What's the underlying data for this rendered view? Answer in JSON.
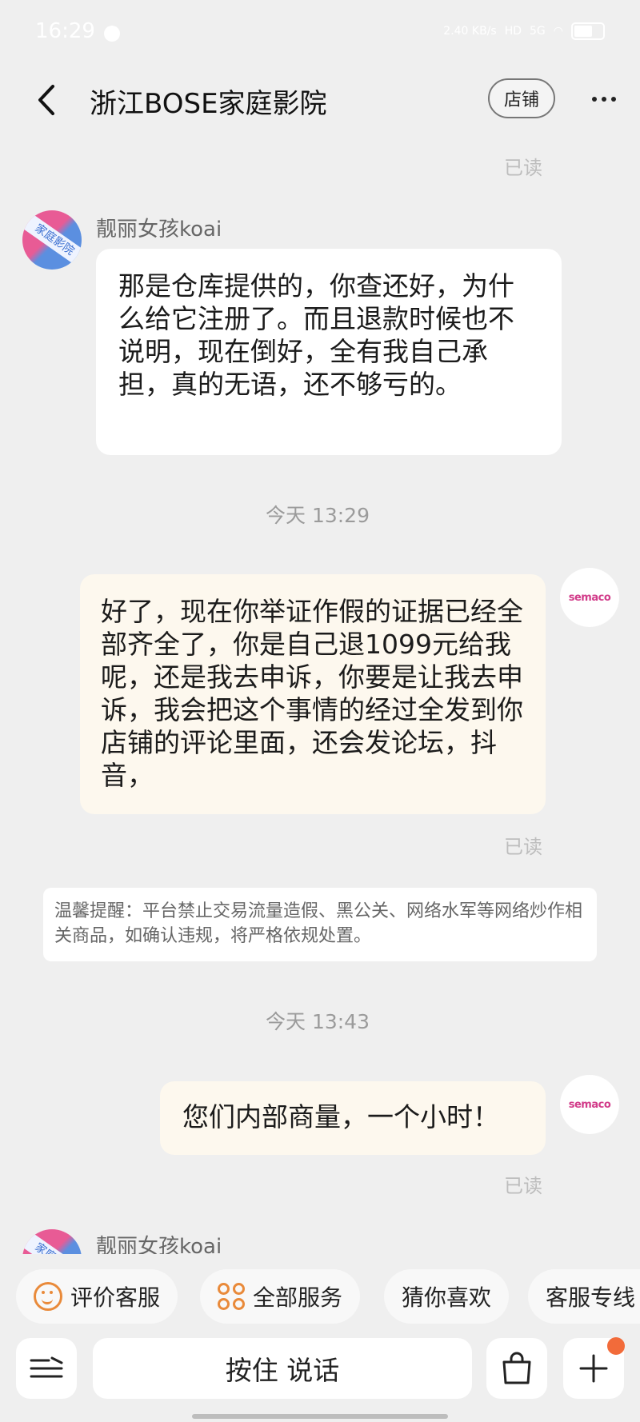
{
  "status_bar": {
    "time": "16:29",
    "speed": "2.40 KB/s",
    "hd": "HD",
    "network": "5G"
  },
  "header": {
    "title": "浙江BOSE家庭影院",
    "store_label": "店铺"
  },
  "read_label": "已读",
  "messages": [
    {
      "sender": "靓丽女孩koai",
      "text": "那是仓库提供的，你查还好，为什么给它注册了。而且退款时候也不说明，现在倒好，全有我自己承担，真的无语，还不够亏的。"
    },
    {
      "timestamp": "今天  13:29"
    },
    {
      "text": "好了，现在你举证作假的证据已经全部齐全了，你是自己退1099元给我呢，还是我去申诉，你要是让我去申诉，我会把这个事情的经过全发到你店铺的评论里面，还会发论坛，抖音，",
      "read": "已读"
    },
    {
      "notice": "温馨提醒：平台禁止交易流量造假、黑公关、网络水军等网络炒作相关商品，如确认违规，将严格依规处置。"
    },
    {
      "timestamp": "今天  13:43"
    },
    {
      "text": "您们内部商量，一个小时！",
      "read": "已读"
    },
    {
      "sender": "靓丽女孩koai"
    }
  ],
  "avatar_left_text": "家庭影院",
  "avatar_right_text": "semaco",
  "quick_actions": [
    {
      "label": "评价客服",
      "icon": "smile-icon"
    },
    {
      "label": "全部服务",
      "icon": "grid-icon"
    },
    {
      "label": "猜你喜欢"
    },
    {
      "label": "客服专线"
    }
  ],
  "input_bar": {
    "hold_to_talk": "按住 说话"
  }
}
